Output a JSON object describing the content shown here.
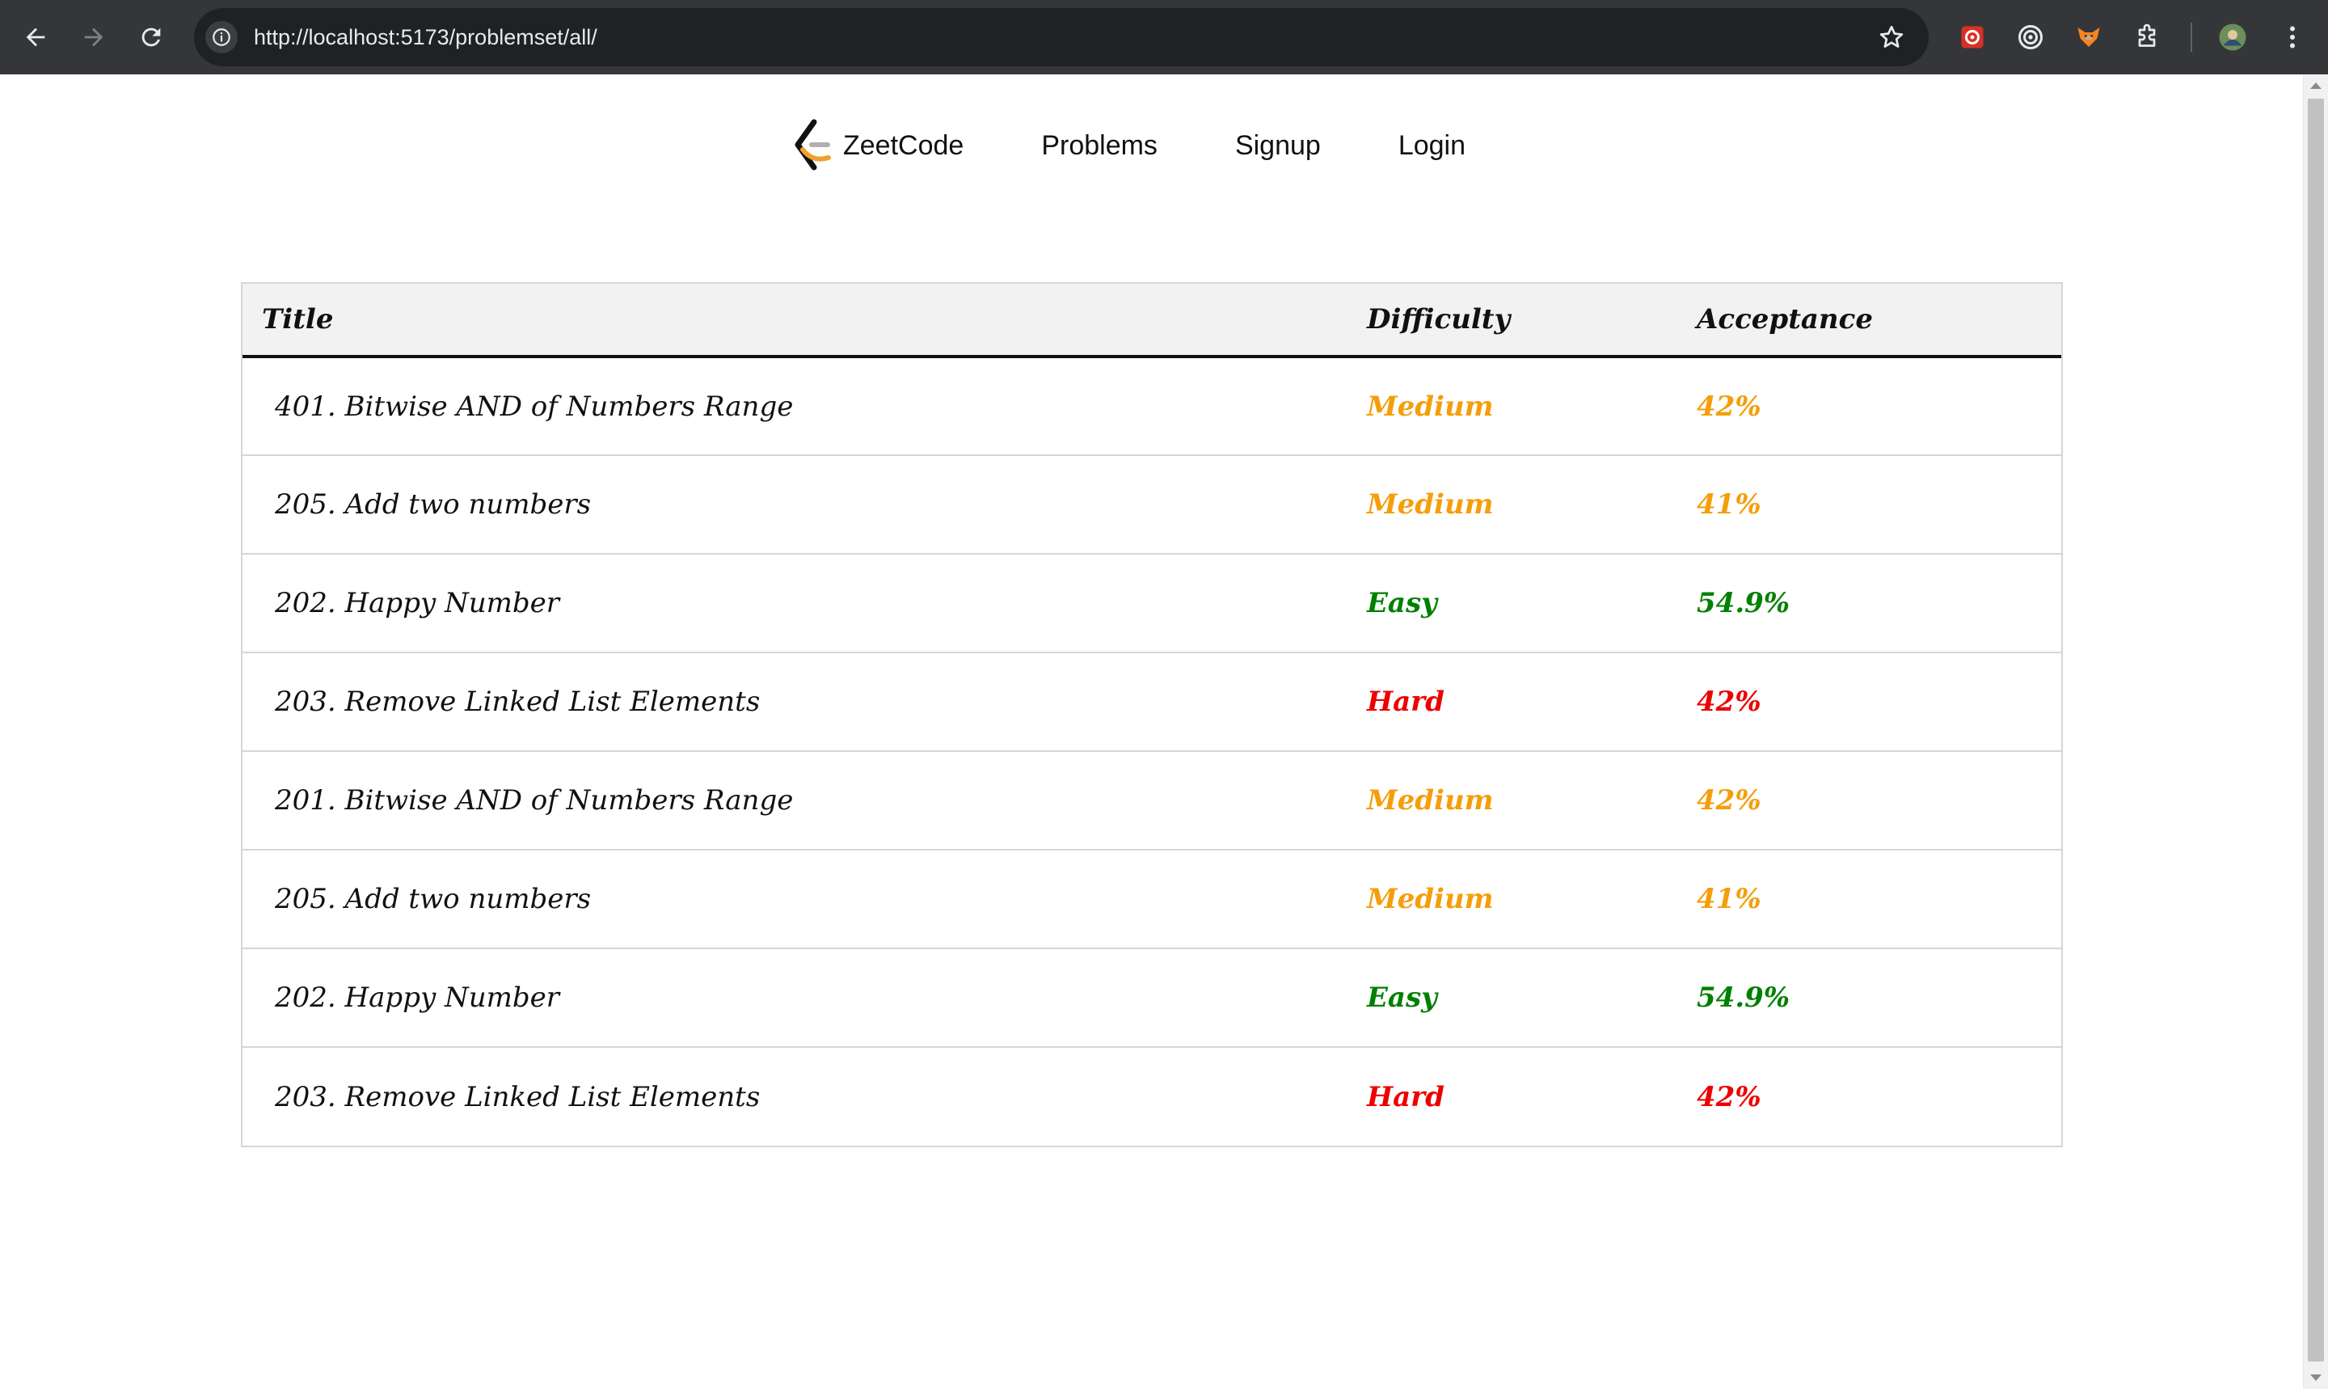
{
  "browser": {
    "url": "http://localhost:5173/problemset/all/",
    "icons": [
      "back-arrow-icon",
      "forward-arrow-icon",
      "reload-icon",
      "site-info-icon",
      "bookmark-star-icon",
      "extension-icons",
      "puzzle-icon",
      "profile-avatar",
      "more-menu-icon"
    ]
  },
  "navbar": {
    "brand": "ZeetCode",
    "links": [
      "Problems",
      "Signup",
      "Login"
    ]
  },
  "table": {
    "headers": {
      "title": "Title",
      "difficulty": "Difficulty",
      "acceptance": "Acceptance"
    },
    "rows": [
      {
        "title": "401. Bitwise AND of Numbers Range",
        "difficulty": "Medium",
        "acceptance": "42%",
        "color": "#f59e0b"
      },
      {
        "title": "205. Add two numbers",
        "difficulty": "Medium",
        "acceptance": "41%",
        "color": "#f59e0b"
      },
      {
        "title": "202. Happy Number",
        "difficulty": "Easy",
        "acceptance": "54.9%",
        "color": "#008000"
      },
      {
        "title": "203. Remove Linked List Elements",
        "difficulty": "Hard",
        "acceptance": "42%",
        "color": "#ee0000"
      },
      {
        "title": "201. Bitwise AND of Numbers Range",
        "difficulty": "Medium",
        "acceptance": "42%",
        "color": "#f59e0b"
      },
      {
        "title": "205. Add two numbers",
        "difficulty": "Medium",
        "acceptance": "41%",
        "color": "#f59e0b"
      },
      {
        "title": "202. Happy Number",
        "difficulty": "Easy",
        "acceptance": "54.9%",
        "color": "#008000"
      },
      {
        "title": "203. Remove Linked List Elements",
        "difficulty": "Hard",
        "acceptance": "42%",
        "color": "#ee0000"
      }
    ]
  },
  "colors": {
    "chrome_bg": "#35363a",
    "urlbar_bg": "#202124",
    "medium": "#f59e0b",
    "easy": "#008000",
    "hard": "#ee0000"
  }
}
